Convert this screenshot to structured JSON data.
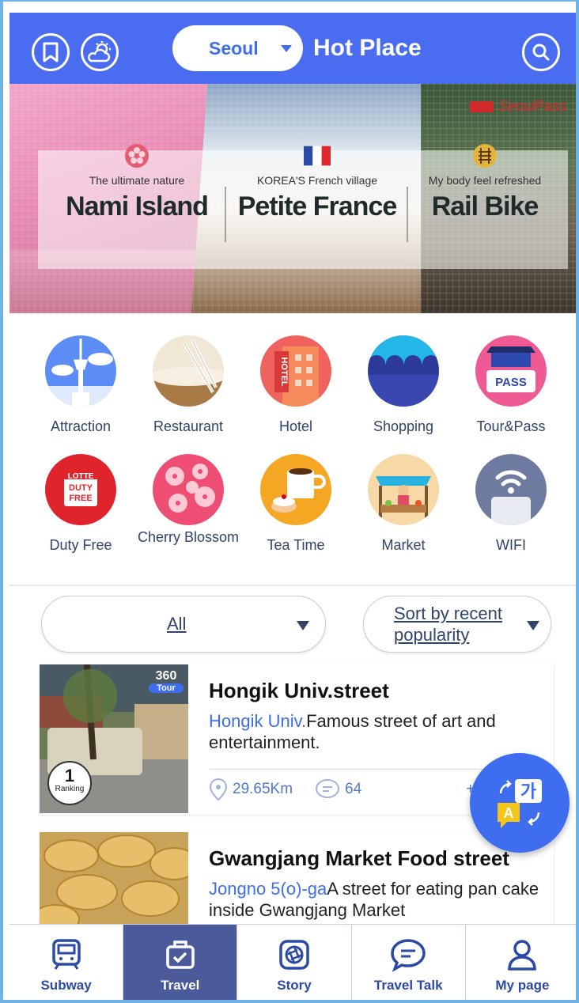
{
  "header": {
    "city": "Seoul",
    "title": "Hot Place",
    "icons": [
      "bookmark-icon",
      "weather-icon",
      "search-icon"
    ]
  },
  "banner": {
    "badge": "SeoulPass",
    "items": [
      {
        "sub": "The ultimate nature",
        "main": "Nami Island",
        "icon": "cherry-blossom-icon"
      },
      {
        "sub": "KOREA'S French village",
        "main": "Petite France",
        "icon": "france-flag-icon"
      },
      {
        "sub": "My body feel refreshed",
        "main": "Rail Bike",
        "icon": "rail-icon"
      }
    ]
  },
  "categories": [
    {
      "label": "Attraction",
      "icon": "tower-icon"
    },
    {
      "label": "Restaurant",
      "icon": "bowl-icon"
    },
    {
      "label": "Hotel",
      "icon": "hotel-icon"
    },
    {
      "label": "Shopping",
      "icon": "awning-icon"
    },
    {
      "label": "Tour&Pass",
      "icon": "pass-icon"
    },
    {
      "label": "Duty Free",
      "icon": "duty-free-icon",
      "badge_lines": [
        "LOTTE",
        "DUTY",
        "FREE"
      ]
    },
    {
      "label": "Cherry Blossom",
      "icon": "cherry-blossom-icon"
    },
    {
      "label": "Tea Time",
      "icon": "coffee-icon"
    },
    {
      "label": "Market",
      "icon": "market-stall-icon"
    },
    {
      "label": "WIFI",
      "icon": "wifi-icon"
    }
  ],
  "filters": {
    "area": "All",
    "sort": "Sort by recent popularity"
  },
  "places": [
    {
      "title": "Hongik Univ.street",
      "station": "Hongik Univ.",
      "desc": "Famous street of art and entertainment.",
      "distance": "29.65Km",
      "comments": "64",
      "extra": "+3",
      "rank": "1",
      "rank_label": "Ranking",
      "tour_badge": "360",
      "tour_label": "Tour"
    },
    {
      "title": "Gwangjang Market Food street",
      "station": "Jongno 5(o)-ga",
      "desc": "A street for eating pan cake inside Gwangjang Market"
    }
  ],
  "fab": {
    "icon": "translate-icon",
    "glyph_a": "A",
    "glyph_b": "가"
  },
  "nav": [
    {
      "label": "Subway",
      "icon": "subway-icon",
      "active": false
    },
    {
      "label": "Travel",
      "icon": "suitcase-icon",
      "active": true
    },
    {
      "label": "Story",
      "icon": "aperture-icon",
      "active": false
    },
    {
      "label": "Travel Talk",
      "icon": "chat-icon",
      "active": false
    },
    {
      "label": "My page",
      "icon": "user-icon",
      "active": false
    }
  ],
  "colors": {
    "primary": "#4a6cf0",
    "nav_active": "#4a5a9a",
    "link": "#3e6df0"
  }
}
